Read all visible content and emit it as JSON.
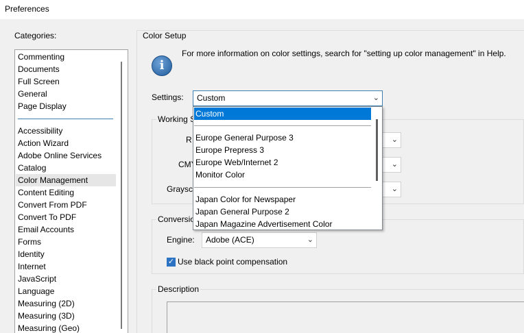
{
  "window": {
    "title": "Preferences"
  },
  "categories": {
    "label": "Categories:",
    "top_items": [
      "Commenting",
      "Documents",
      "Full Screen",
      "General",
      "Page Display"
    ],
    "items": [
      "Accessibility",
      "Action Wizard",
      "Adobe Online Services",
      "Catalog",
      "Color Management",
      "Content Editing",
      "Convert From PDF",
      "Convert To PDF",
      "Email Accounts",
      "Forms",
      "Identity",
      "Internet",
      "JavaScript",
      "Language",
      "Measuring (2D)",
      "Measuring (3D)",
      "Measuring (Geo)"
    ],
    "selected": "Color Management"
  },
  "color_setup": {
    "title": "Color Setup",
    "info": "For more information on color settings, search for \"setting up color management\" in Help.",
    "settings_label": "Settings:",
    "settings_value": "Custom"
  },
  "working_spaces": {
    "title": "Working S",
    "rgb_label": "R",
    "cmyk_label": "CMY",
    "gray_label": "Graysca"
  },
  "conversion": {
    "title": "Conversio",
    "engine_label": "Engine:",
    "engine_value": "Adobe (ACE)",
    "bpc_label": "Use black point compensation",
    "bpc_checked": true
  },
  "description": {
    "title": "Description"
  },
  "dropdown": {
    "selected": "Custom",
    "group1": [
      "Europe General Purpose 3",
      "Europe Prepress 3",
      "Europe Web/Internet 2",
      "Monitor Color"
    ],
    "group2": [
      "Japan Color for Newspaper",
      "Japan General Purpose 2",
      "Japan Magazine Advertisement Color"
    ]
  },
  "colors": {
    "accent": "#0078d7",
    "selection_bg": "#e6e6e6",
    "focus_border": "#3c7fb1"
  },
  "icons": {
    "info": "info-icon",
    "chevron": "chevron-down-icon",
    "check": "check-icon"
  }
}
